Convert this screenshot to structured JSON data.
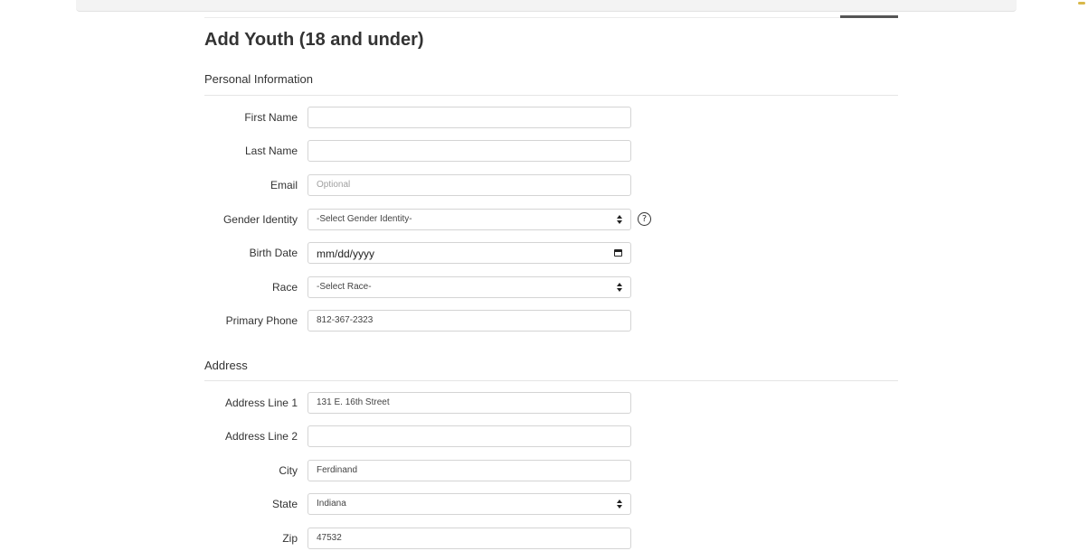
{
  "page": {
    "title": "Add Youth (18 and under)"
  },
  "sections": {
    "personal": "Personal Information",
    "address": "Address"
  },
  "personal_fields": {
    "first_name": {
      "label": "First Name",
      "value": ""
    },
    "last_name": {
      "label": "Last Name",
      "value": ""
    },
    "email": {
      "label": "Email",
      "placeholder": "Optional",
      "value": ""
    },
    "gender_identity": {
      "label": "Gender Identity",
      "selected": "-Select Gender Identity-",
      "help_icon": "question-circle-icon"
    },
    "birth_date": {
      "label": "Birth Date",
      "value": "mm/dd/yyyy",
      "icon": "calendar-icon"
    },
    "race": {
      "label": "Race",
      "selected": "-Select Race-"
    },
    "primary_phone": {
      "label": "Primary Phone",
      "value": "812-367-2323"
    }
  },
  "address_fields": {
    "line1": {
      "label": "Address Line 1",
      "value": "131 E. 16th Street"
    },
    "line2": {
      "label": "Address Line 2",
      "value": ""
    },
    "city": {
      "label": "City",
      "value": "Ferdinand"
    },
    "state": {
      "label": "State",
      "selected": "Indiana"
    },
    "zip": {
      "label": "Zip",
      "value": "47532"
    }
  }
}
